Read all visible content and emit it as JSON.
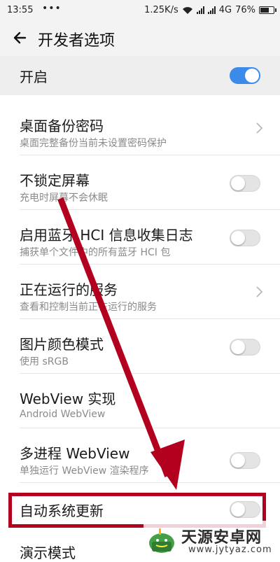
{
  "status_bar": {
    "time": "13:55",
    "dots": "•••",
    "speed": "1.25K/s",
    "network": "4G",
    "battery": "76%",
    "battery_level": 0.76
  },
  "app_bar": {
    "title": "开发者选项"
  },
  "master": {
    "label": "开启",
    "state": "on"
  },
  "settings": [
    {
      "title": "桌面备份密码",
      "subtitle": "桌面完整备份当前未设置密码保护",
      "control": "chevron"
    },
    {
      "title": "不锁定屏幕",
      "subtitle": "充电时屏幕不会休眠",
      "control": "toggle-off"
    },
    {
      "title": "启用蓝牙 HCI 信息收集日志",
      "subtitle": "捕获单个文件中的所有蓝牙 HCI 包",
      "control": "toggle-off"
    },
    {
      "title": "正在运行的服务",
      "subtitle": "查看和控制当前正在运行的服务",
      "control": "chevron"
    },
    {
      "title": "图片颜色模式",
      "subtitle": "使用 sRGB",
      "control": "toggle-off"
    },
    {
      "title": "WebView 实现",
      "subtitle": "Android WebView",
      "control": "none"
    },
    {
      "title": "多进程 WebView",
      "subtitle": "单独运行 WebView 渲染程序",
      "control": "toggle-off"
    },
    {
      "title": "自动系统更新",
      "subtitle": "",
      "control": "toggle-off"
    },
    {
      "title": "演示模式",
      "subtitle": "",
      "control": "none"
    }
  ],
  "colors": {
    "accent": "#3b8beb",
    "annotation": "#b3001e"
  },
  "watermark": {
    "name": "天源安卓网",
    "url": "www.jytyaz.com"
  }
}
